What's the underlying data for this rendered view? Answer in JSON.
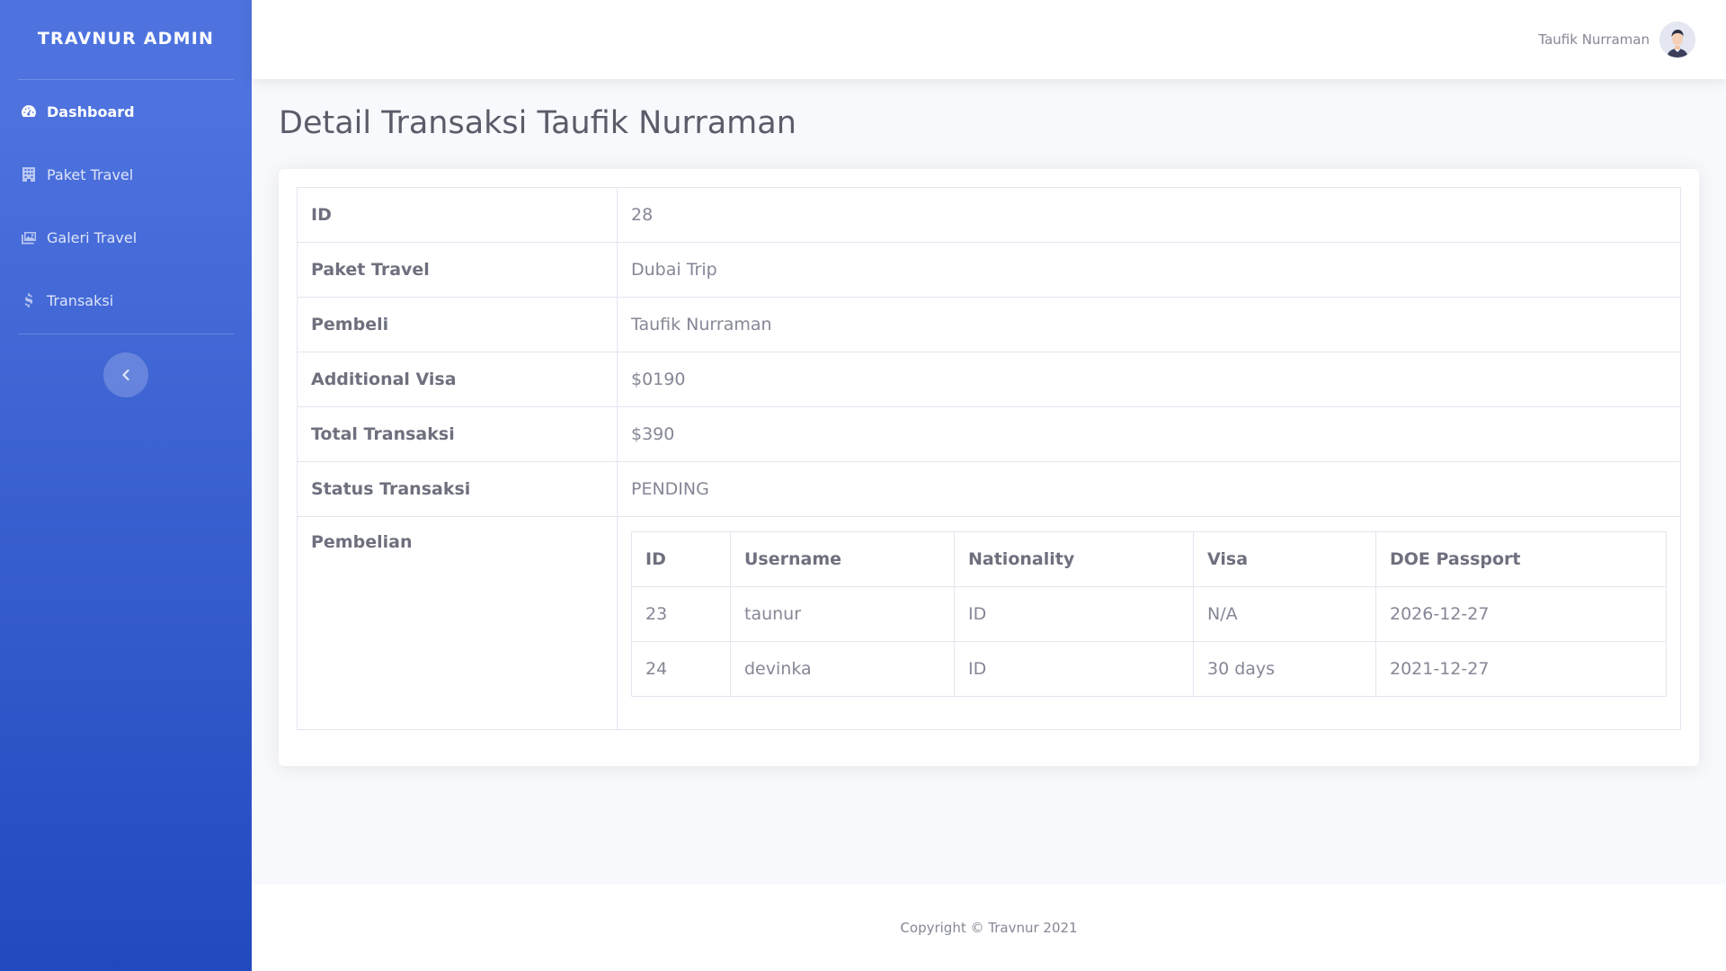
{
  "brand": "TRAVNUR ADMIN",
  "sidebar": {
    "items": [
      {
        "label": "Dashboard",
        "icon": "tachometer-icon",
        "active": true
      },
      {
        "label": "Paket Travel",
        "icon": "building-icon",
        "active": false
      },
      {
        "label": "Galeri Travel",
        "icon": "images-icon",
        "active": false
      },
      {
        "label": "Transaksi",
        "icon": "dollar-icon",
        "active": false
      }
    ],
    "toggle_icon": "chevron-left-icon"
  },
  "topbar": {
    "user_name": "Taufik Nurraman",
    "avatar_icon": "user-avatar"
  },
  "page": {
    "title": "Detail Transaksi Taufik Nurraman"
  },
  "details": {
    "rows": [
      {
        "label": "ID",
        "value": "28"
      },
      {
        "label": "Paket Travel",
        "value": "Dubai Trip"
      },
      {
        "label": "Pembeli",
        "value": "Taufik Nurraman"
      },
      {
        "label": "Additional Visa",
        "value": "$0190"
      },
      {
        "label": "Total Transaksi",
        "value": "$390"
      },
      {
        "label": "Status Transaksi",
        "value": "PENDING"
      }
    ],
    "purchase_label": "Pembelian"
  },
  "purchases": {
    "columns": [
      "ID",
      "Username",
      "Nationality",
      "Visa",
      "DOE Passport"
    ],
    "rows": [
      [
        "23",
        "taunur",
        "ID",
        "N/A",
        "2026-12-27"
      ],
      [
        "24",
        "devinka",
        "ID",
        "30 days",
        "2021-12-27"
      ]
    ]
  },
  "footer": {
    "text": "Copyright © Travnur 2021"
  },
  "colors": {
    "primary": "#4e73df",
    "primary_dark": "#224abe",
    "text": "#858796",
    "heading": "#5a5c69"
  }
}
